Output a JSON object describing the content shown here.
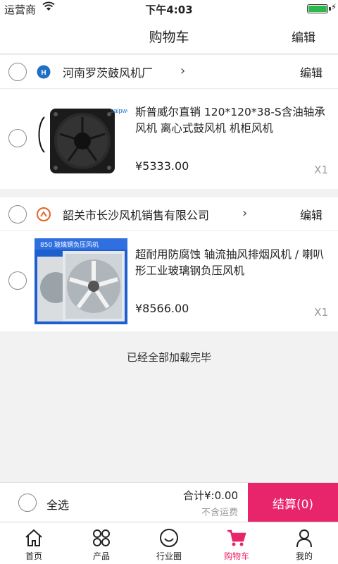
{
  "status_bar": {
    "carrier": "运营商",
    "time": "下午4:03"
  },
  "nav": {
    "title": "购物车",
    "edit": "编辑"
  },
  "shops": [
    {
      "name": "河南罗茨鼓风机厂",
      "edit": "编辑",
      "logo_color": "#1f6fc4",
      "item": {
        "title": "斯普威尔直销 120*120*38-S含油轴承风机 离心式鼓风机 机柜风机",
        "price": "¥5333.00",
        "qty": "X1",
        "image_brand": "saipwell"
      }
    },
    {
      "name": "韶关市长沙风机销售有限公司",
      "edit": "编辑",
      "logo_color": "#e0642a",
      "item": {
        "title": "超耐用防腐蚀 轴流抽风排烟风机 / 喇叭形工业玻璃钢负压风机",
        "price": "¥8566.00",
        "qty": "X1",
        "image_banner": "850 玻璃钢负压风机"
      }
    }
  ],
  "loaded_text": "已经全部加载完毕",
  "checkout": {
    "select_all": "全选",
    "total": "合计¥:0.00",
    "shipping": "不含运费",
    "settle": "结算(0)"
  },
  "tabs": [
    {
      "label": "首页",
      "icon": "home-icon"
    },
    {
      "label": "产品",
      "icon": "grid-icon"
    },
    {
      "label": "行业圈",
      "icon": "smile-icon"
    },
    {
      "label": "购物车",
      "icon": "cart-icon",
      "active": true
    },
    {
      "label": "我的",
      "icon": "user-icon"
    }
  ],
  "colors": {
    "accent": "#e8246a",
    "battery": "#2db84d"
  }
}
